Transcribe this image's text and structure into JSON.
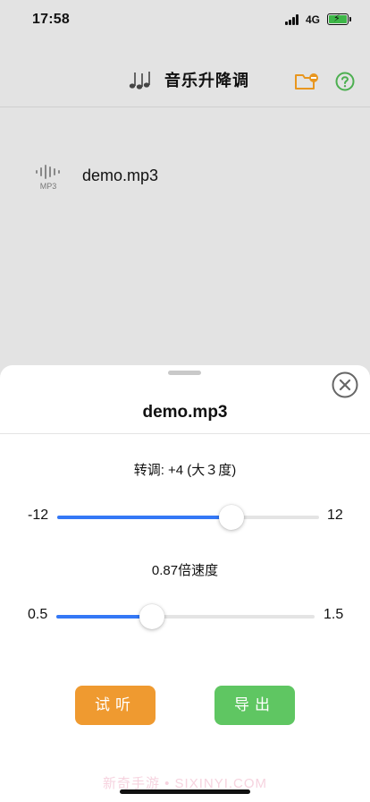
{
  "status_bar": {
    "time": "17:58",
    "network": "4G",
    "battery_color": "#3db748"
  },
  "nav": {
    "icon": "music-notes-icon",
    "title": "音乐升降调",
    "folder_icon": "folder-remove-icon",
    "help_icon": "help-circle-icon",
    "accent_orange": "#e8961f",
    "accent_green": "#4caf50"
  },
  "files": [
    {
      "name": "demo.mp3",
      "type_label": "MP3",
      "icon": "audio-waveform-icon"
    }
  ],
  "sheet": {
    "title": "demo.mp3",
    "close_icon": "close-circle-icon",
    "pitch": {
      "label": "转调: +4 (大３度)",
      "min_label": "-12",
      "max_label": "12",
      "min": -12,
      "max": 12,
      "value": 4
    },
    "speed": {
      "label": "0.87倍速度",
      "min_label": "0.5",
      "max_label": "1.5",
      "min": 0.5,
      "max": 1.5,
      "value": 0.87
    },
    "slider_color": "#3478f6",
    "preview_button": {
      "label": "试听",
      "color": "#ef9a30"
    },
    "export_button": {
      "label": "导出",
      "color": "#5fc662"
    }
  },
  "watermark": "新奇手游 • SIXINYI.COM"
}
